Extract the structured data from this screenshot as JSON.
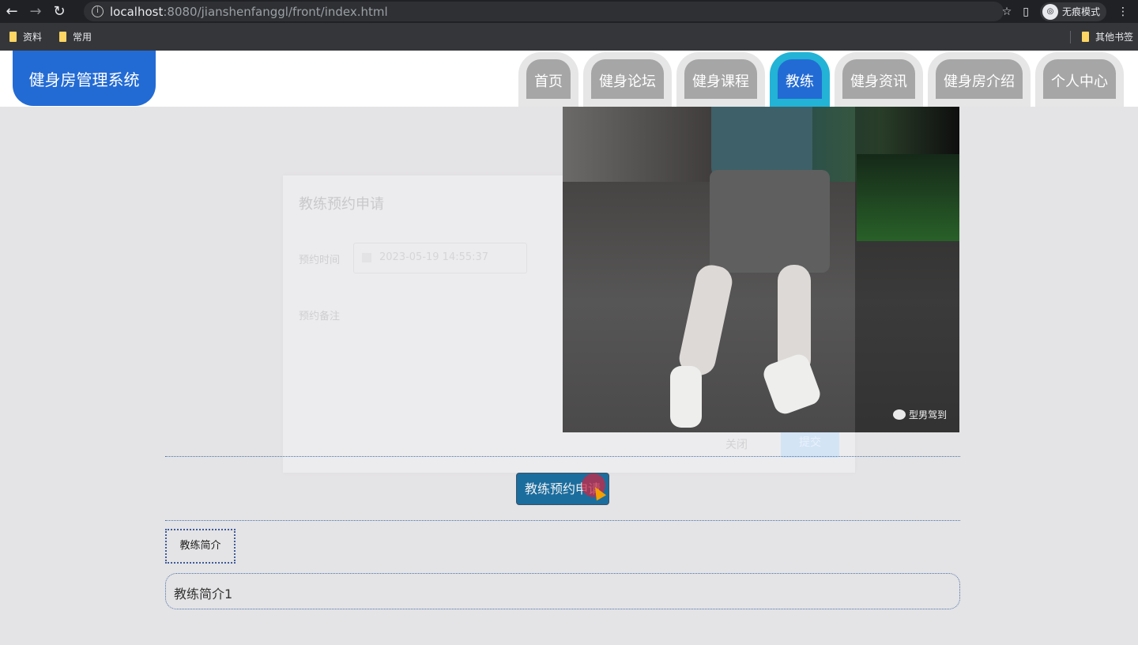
{
  "browser": {
    "url_host": "localhost",
    "url_rest": ":8080/jianshenfanggl/front/index.html",
    "incognito_label": "无痕模式",
    "bookmarks": [
      "资料",
      "常用"
    ],
    "other_bookmarks": "其他书签"
  },
  "header": {
    "logo": "健身房管理系统",
    "tabs": [
      {
        "label": "首页"
      },
      {
        "label": "健身论坛"
      },
      {
        "label": "健身课程"
      },
      {
        "label": "教练",
        "active": true
      },
      {
        "label": "健身资讯"
      },
      {
        "label": "健身房介绍"
      },
      {
        "label": "个人中心"
      }
    ]
  },
  "modal": {
    "title": "教练预约申请",
    "time_label": "预约时间",
    "time_value": "2023-05-19 14:55:37",
    "note_label": "预约备注",
    "close_label": "关闭",
    "submit_label": "提交"
  },
  "photo": {
    "watermark": "型男驾到"
  },
  "apply_button": "教练预约申请",
  "intro": {
    "tab_label": "教练简介",
    "content": "教练简介1"
  },
  "colors": {
    "brand": "#236bd4",
    "active_tab_border": "#22b3d6",
    "apply_button": "#1b6d9e"
  }
}
